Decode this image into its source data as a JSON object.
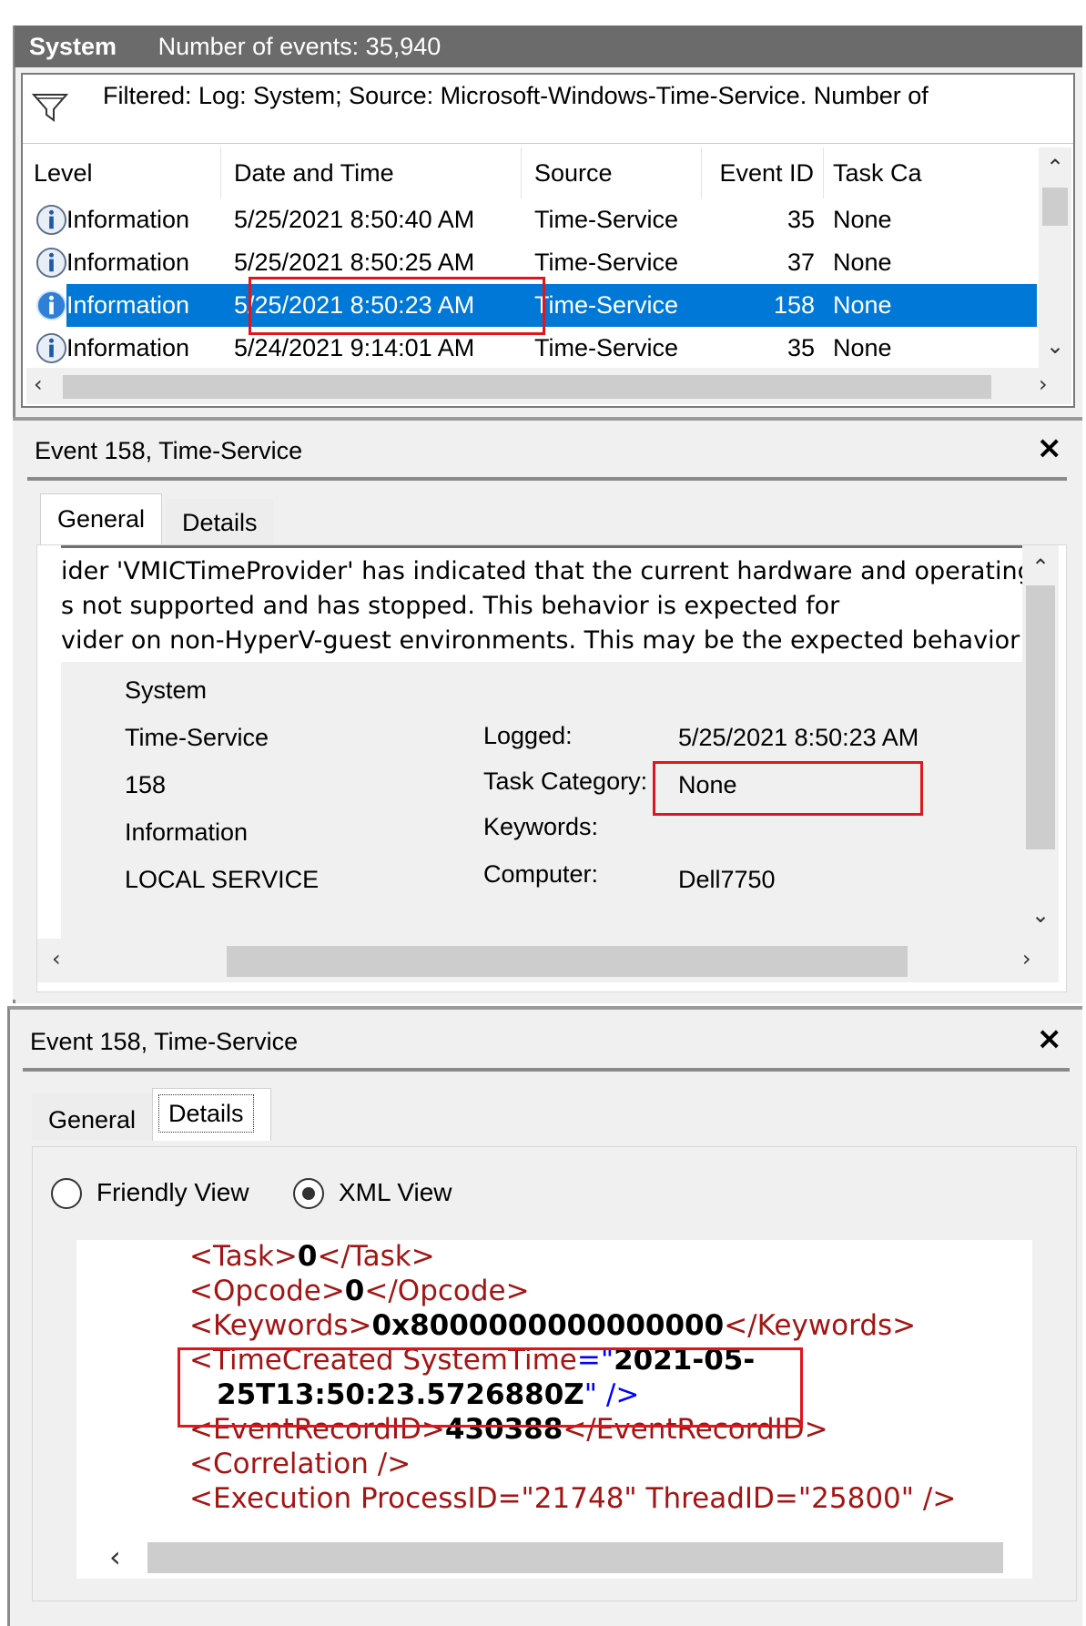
{
  "log_header": {
    "title": "System",
    "event_count": "Number of events: 35,940"
  },
  "filter": {
    "icon": "funnel-icon",
    "text": "Filtered: Log: System; Source: Microsoft-Windows-Time-Service. Number of"
  },
  "table": {
    "columns": [
      "Level",
      "Date and Time",
      "Source",
      "Event ID",
      "Task Ca"
    ],
    "rows": [
      {
        "level": "Information",
        "datetime": "5/25/2021 8:50:40 AM",
        "source": "Time-Service",
        "event_id": "35",
        "task": "None"
      },
      {
        "level": "Information",
        "datetime": "5/25/2021 8:50:25 AM",
        "source": "Time-Service",
        "event_id": "37",
        "task": "None"
      },
      {
        "level": "Information",
        "datetime": "5/25/2021 8:50:23 AM",
        "source": "Time-Service",
        "event_id": "158",
        "task": "None"
      },
      {
        "level": "Information",
        "datetime": "5/24/2021 9:14:01 AM",
        "source": "Time-Service",
        "event_id": "35",
        "task": "None"
      }
    ],
    "selected_index": 2
  },
  "detail_general": {
    "title": "Event 158, Time-Service",
    "tabs": [
      "General",
      "Details"
    ],
    "active_tab": "General",
    "message_lines": [
      "ider 'VMICTimeProvider' has indicated that the current hardware and operating",
      "s not supported and has stopped. This behavior is expected for",
      "vider on non-HyperV-guest environments. This may be the expected behavior fc"
    ],
    "values_left": [
      "System",
      "Time-Service",
      "158",
      "Information",
      "LOCAL SERVICE"
    ],
    "fields_right": [
      {
        "label": "Logged:",
        "value": "5/25/2021 8:50:23 AM"
      },
      {
        "label": "Task Category:",
        "value": "None"
      },
      {
        "label": "Keywords:",
        "value": ""
      },
      {
        "label": "Computer:",
        "value": "Dell7750"
      }
    ]
  },
  "detail_xml": {
    "title": "Event 158, Time-Service",
    "tabs": [
      "General",
      "Details"
    ],
    "active_tab": "Details",
    "view_options": [
      {
        "label": "Friendly View",
        "selected": false
      },
      {
        "label": "XML View",
        "selected": true
      }
    ],
    "xml": {
      "task_open": "<Task>",
      "task_val": "0",
      "task_close": "</Task>",
      "opcode_open": "<Opcode>",
      "opcode_val": "0",
      "opcode_close": "</Opcode>",
      "keywords_open": "<Keywords>",
      "keywords_val": "0x8000000000000000",
      "keywords_close": "</Keywords>",
      "timecreated_tag": "<TimeCreated",
      "timecreated_attr": " SystemTime",
      "timecreated_eq": "=\"",
      "timecreated_val1": "2021-05-",
      "timecreated_val2": "25T13:50:23.5726880Z",
      "timecreated_end_quote": "\"",
      "timecreated_close": " />",
      "recordid_open": "<EventRecordID>",
      "recordid_val": "430388",
      "recordid_close": "</EventRecordID>",
      "correlation": "<Correlation />",
      "execution_partial": "<Execution ProcessID=\"21748\" ThreadID=\"25800\" />"
    }
  },
  "colors": {
    "selection": "#0078d7",
    "highlight_box": "#e0161c",
    "xml_tag": "#a31515",
    "xml_bracket": "#0000ff"
  }
}
